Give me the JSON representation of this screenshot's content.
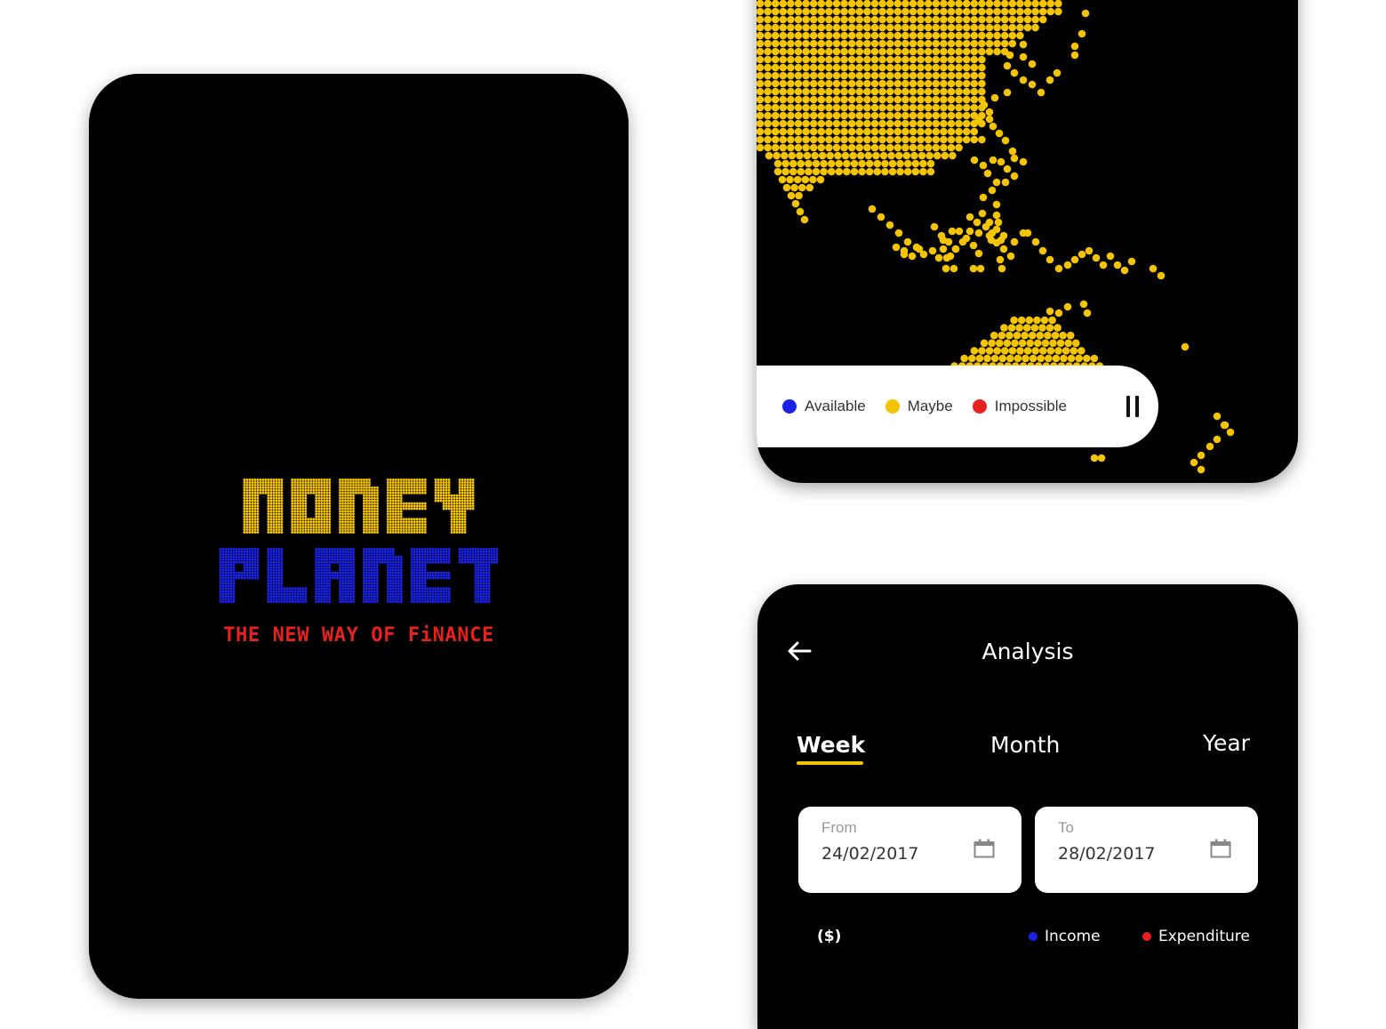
{
  "splash": {
    "title_line1": "MONEY",
    "title_line2": "PLANET",
    "tagline": "THE NEW WAY OF FiNANCE",
    "colors": {
      "line1": "#f5c400",
      "line2": "#1a22e6",
      "tagline": "#e8211f"
    }
  },
  "map": {
    "dot_color": "#f5c400",
    "legend": [
      {
        "label": "Available",
        "color": "#1a22e6"
      },
      {
        "label": "Maybe",
        "color": "#f5c400"
      },
      {
        "label": "Impossible",
        "color": "#e8211f"
      }
    ],
    "control_icon": "pause-icon"
  },
  "analysis": {
    "title": "Analysis",
    "back_icon": "arrow-left-icon",
    "tabs": [
      {
        "label": "Week",
        "active": true
      },
      {
        "label": "Month",
        "active": false
      },
      {
        "label": "Year",
        "active": false
      }
    ],
    "from": {
      "label": "From",
      "value": "24/02/2017"
    },
    "to": {
      "label": "To",
      "value": "28/02/2017"
    },
    "calendar_icon": "calendar-icon",
    "unit": "($)",
    "series": [
      {
        "label": "Income",
        "color": "#1a22e6"
      },
      {
        "label": "Expenditure",
        "color": "#e8211f"
      }
    ]
  }
}
